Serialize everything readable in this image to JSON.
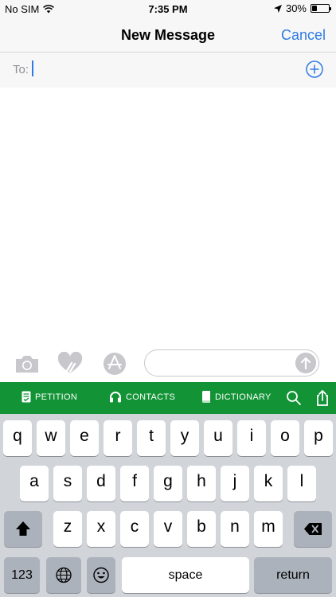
{
  "status_bar": {
    "carrier": "No SIM",
    "time": "7:35 PM",
    "battery": "30%",
    "battery_level": 0.3
  },
  "nav": {
    "title": "New Message",
    "cancel_label": "Cancel"
  },
  "recipient": {
    "label": "To:",
    "value": ""
  },
  "compose": {
    "value": ""
  },
  "toolbar": {
    "petition": "PETITION",
    "contacts": "CONTACTS",
    "dictionary": "DICTIONARY"
  },
  "keyboard": {
    "row1": [
      "q",
      "w",
      "e",
      "r",
      "t",
      "y",
      "u",
      "i",
      "o",
      "p"
    ],
    "row2": [
      "a",
      "s",
      "d",
      "f",
      "g",
      "h",
      "j",
      "k",
      "l"
    ],
    "row3": [
      "z",
      "x",
      "c",
      "v",
      "b",
      "n",
      "m"
    ],
    "numbers": "123",
    "space": "space",
    "return": "return"
  },
  "colors": {
    "accent": "#2f7ae5",
    "toolbar": "#129336",
    "keyboard_bg": "#d1d4d9"
  },
  "icons": {
    "wifi": "wifi-icon",
    "location": "location-arrow-icon",
    "add": "add-contact-icon",
    "camera": "camera-icon",
    "digital_touch": "digital-touch-icon",
    "app_store": "app-store-icon",
    "send": "send-arrow-icon",
    "petition": "petition-icon",
    "contacts": "headphones-icon",
    "dictionary": "book-icon",
    "search": "search-icon",
    "share": "share-icon",
    "shift": "shift-icon",
    "delete": "backspace-icon",
    "globe": "globe-icon",
    "emoji": "emoji-icon"
  }
}
